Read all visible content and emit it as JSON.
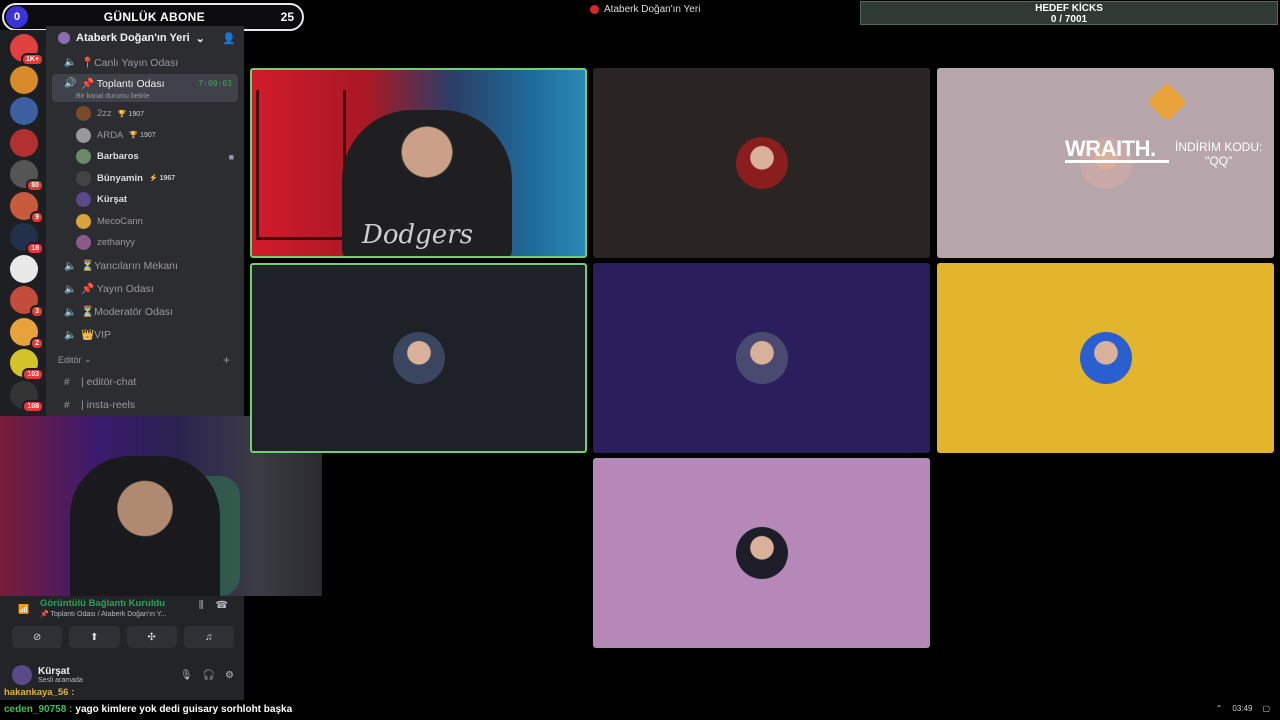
{
  "overlay": {
    "abone_label": "GÜNLÜK ABONE",
    "abone_left": "0",
    "abone_count": "25",
    "hedef_title": "HEDEF KİCKS",
    "hedef_value": "0 / 7001"
  },
  "window": {
    "title": "Ataberk Doğan'ın Yeri"
  },
  "rail": {
    "servers": [
      {
        "badge": "1K+",
        "color": "#e04040"
      },
      {
        "badge": "",
        "color": "#d98a2a"
      },
      {
        "badge": "",
        "color": "#3b5fa0"
      },
      {
        "badge": "",
        "color": "#b33030"
      },
      {
        "badge": "80",
        "color": "#555"
      },
      {
        "badge": "9",
        "color": "#c75a3a"
      },
      {
        "badge": "18",
        "color": "#22304a"
      },
      {
        "badge": "",
        "color": "#e8e8e8"
      },
      {
        "badge": "3",
        "color": "#c24b3a"
      },
      {
        "badge": "2",
        "color": "#e8a23a"
      },
      {
        "badge": "103",
        "color": "#d4c22a"
      },
      {
        "badge": "108",
        "color": "#333"
      }
    ]
  },
  "sidebar": {
    "server_name": "Ataberk Doğan'ın Yeri",
    "channels_top": [
      {
        "name": "📍Canlı Yayın Odası"
      }
    ],
    "active_channel": {
      "name": "📌 Toplantı Odası",
      "sub": "Bir kanal durumu belirle",
      "timer": "7:00:03"
    },
    "members": [
      {
        "name": "2zz",
        "tag": "🏆 1907",
        "dim": true,
        "color": "#7a4a2a"
      },
      {
        "name": "ARDA",
        "tag": "🏆 1907",
        "dim": true,
        "color": "#999"
      },
      {
        "name": "Barbaros",
        "tag": "",
        "dim": false,
        "color": "#6a8a6a",
        "cam": true
      },
      {
        "name": "Bünyamin",
        "tag": "⚡ 1967",
        "dim": false,
        "color": "#444"
      },
      {
        "name": "Kürşat",
        "tag": "",
        "dim": false,
        "color": "#5a4a8a"
      },
      {
        "name": "MecoCann",
        "tag": "",
        "dim": true,
        "color": "#d9a23a"
      },
      {
        "name": "zethanyy",
        "tag": "",
        "dim": true,
        "color": "#8a5a8a"
      }
    ],
    "channels_bottom": [
      {
        "name": "⏳Yancıların Mekanı"
      },
      {
        "name": "📌 Yayın Odası"
      },
      {
        "name": "⏳Moderatör Odası"
      },
      {
        "name": "👑VIP"
      }
    ],
    "category": "Editör",
    "text_channels": [
      {
        "name": "| editör-chat"
      },
      {
        "name": "| insta-reels"
      }
    ]
  },
  "voice": {
    "status": "Görüntülü Bağlantı Kuruldu",
    "location": "📌 Toplantı Odası / Ataberk Doğan'ın Y...",
    "user": "Kürşat",
    "user_status": "Sesli aramada"
  },
  "tiles": [
    {
      "id": "t1",
      "speaking": true
    },
    {
      "id": "t2",
      "speaking": false,
      "avatar": "#8a1e1e"
    },
    {
      "id": "t3",
      "speaking": false,
      "avatar": "#c9a8a8"
    },
    {
      "id": "t4",
      "speaking": true,
      "avatar": "#3a4660"
    },
    {
      "id": "t5",
      "speaking": false,
      "avatar": "#4a4a70"
    },
    {
      "id": "t6",
      "speaking": false,
      "avatar": "#2a5fd0"
    },
    {
      "id": "t7",
      "speaking": false,
      "avatar": "#1e1e2a"
    }
  ],
  "t1": {
    "shirt": "Dodgers"
  },
  "t3": {
    "brand": "WRAITH.",
    "kod_line1": "İNDİRİM KODU:",
    "kod_line2": "\"QQ\""
  },
  "chat": [
    {
      "user": "hakankaya_56 :",
      "msg": ""
    },
    {
      "user": "ceden_90758 :",
      "msg": "yago kimlere yok dedi guisary sorhloht başka"
    }
  ],
  "taskbar": {
    "time": "03:49"
  }
}
